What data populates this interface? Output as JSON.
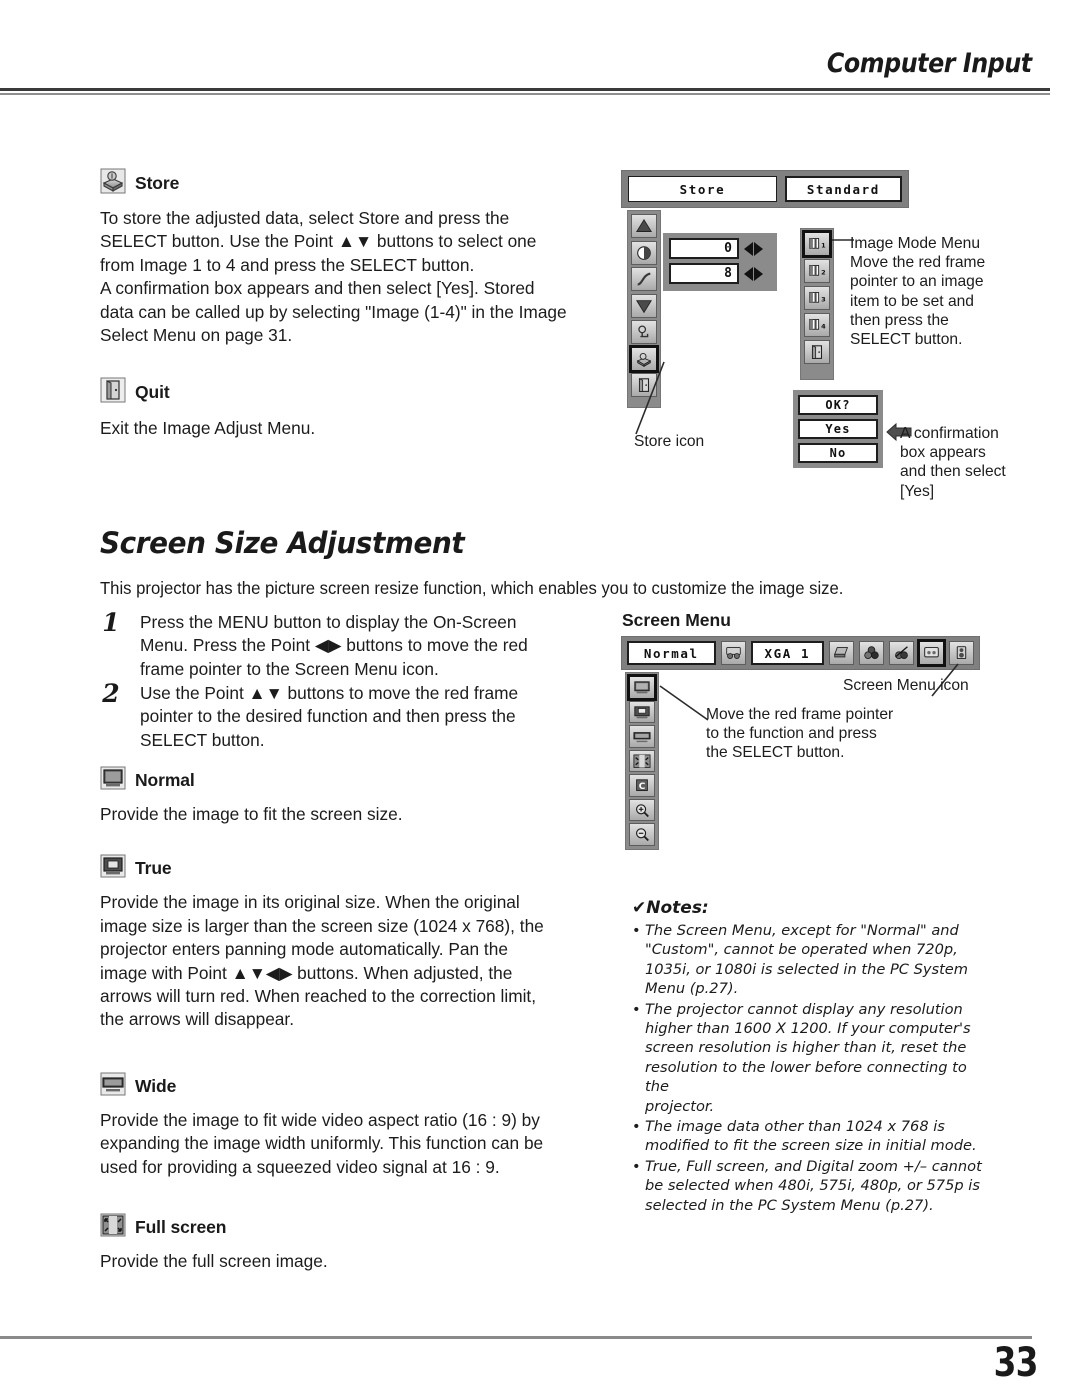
{
  "header": {
    "title": "Computer Input"
  },
  "footer": {
    "page_number": "33"
  },
  "store_section": {
    "heading": "Store",
    "icon": "store-box-icon",
    "body": "To store the adjusted data, select Store and press the\nSELECT button.  Use the Point ▲▼ buttons to select one\nfrom Image 1 to 4 and press the SELECT button.\nA confirmation box appears and then select [Yes]. Stored\ndata can be called up by selecting \"Image (1-4)\" in the Image\nSelect Menu on page 31."
  },
  "quit_section": {
    "heading": "Quit",
    "icon": "door-icon",
    "body": "Exit the Image Adjust Menu."
  },
  "image_adjust_osd": {
    "top_fields": [
      {
        "label": "Store"
      },
      {
        "label": "Standard"
      }
    ],
    "values": [
      "0",
      "8"
    ],
    "left_rail_icons": [
      "contrast-up-icon",
      "brightness-icon",
      "gamma-curve-icon",
      "contrast-down-icon",
      "reset-icon",
      "store-box-icon",
      "door-icon"
    ],
    "selected_left_icon_index": 5,
    "mode_rail_icons": [
      "image-1-icon",
      "image-2-icon",
      "image-3-icon",
      "image-4-icon",
      "door-icon"
    ],
    "mode_rail_labels": [
      "1",
      "2",
      "3",
      "4",
      ""
    ],
    "selected_mode_index": 0,
    "confirm_box": {
      "title": "OK?",
      "yes": "Yes",
      "no": "No"
    },
    "callouts": {
      "image_mode_menu": "Image Mode Menu\nMove the red frame\npointer to an image\nitem to be set and\nthen press the\nSELECT button.",
      "store_icon": "Store icon",
      "confirmation": "A confirmation\nbox appears\nand then select\n[Yes]"
    }
  },
  "screen_size": {
    "title": "Screen Size Adjustment",
    "intro": "This projector has the picture screen resize function, which enables you to customize the image size.",
    "steps": [
      {
        "num": "1",
        "text": "Press the MENU button to display the On-Screen\nMenu.  Press the Point ◀▶ buttons to move the red\nframe pointer to the Screen Menu icon."
      },
      {
        "num": "2",
        "text": "Use the Point ▲▼ buttons to move the red frame\npointer to the desired function and then press the\nSELECT button."
      }
    ],
    "modes": [
      {
        "heading": "Normal",
        "icon": "screen-normal-icon",
        "body": "Provide the image to fit the screen size."
      },
      {
        "heading": "True",
        "icon": "screen-true-icon",
        "body": "Provide the image in its original size.  When the original\nimage size is larger than the screen size (1024 x 768), the\nprojector enters panning mode automatically.  Pan the\nimage with Point ▲▼◀▶ buttons.  When adjusted, the\narrows will turn red.  When reached to the correction limit,\nthe arrows will disappear."
      },
      {
        "heading": "Wide",
        "icon": "screen-wide-icon",
        "body": "Provide the image to fit wide video aspect ratio (16 : 9) by\nexpanding the image width uniformly.  This function can be\nused for providing a squeezed video signal at 16 : 9."
      },
      {
        "heading": "Full screen",
        "icon": "screen-full-icon",
        "body": "Provide the full screen image."
      }
    ]
  },
  "screen_menu_osd": {
    "label": "Screen Menu",
    "fields": [
      {
        "label": "Normal"
      },
      {
        "label": "XGA 1"
      }
    ],
    "bar_icons": [
      "pc-system-icon",
      "laptop-input-icon",
      "color-balls-icon",
      "image-adjust-icon",
      "screen-icon",
      "sound-icon"
    ],
    "selected_bar_icon": "screen-icon",
    "rail_icons": [
      "screen-normal-icon",
      "screen-true-icon",
      "screen-wide-icon",
      "screen-full-icon",
      "custom-c-icon",
      "digital-zoom-in-icon",
      "digital-zoom-out-icon"
    ],
    "selected_rail_index": 0,
    "callouts": {
      "screen_menu_icon": "Screen Menu icon",
      "move_pointer": "Move the red frame pointer\nto  the  function  and  press\nthe SELECT button."
    }
  },
  "notes": {
    "heading": "Notes:",
    "items": [
      "The Screen Menu, except for \"Normal\" and\n\"Custom\", cannot be operated when 720p,\n1035i, or 1080i is selected in the PC System\nMenu  (p.27).",
      "The projector cannot display any resolution\nhigher than 1600 X 1200.  If your computer's\nscreen resolution is higher than it, reset the\nresolution to the lower before connecting to the\nprojector.",
      "The image data other than  1024 x 768  is\nmodified to fit the screen size in initial mode.",
      "True, Full screen, and Digital zoom +/– cannot\nbe selected when 480i, 575i, 480p, or 575p is\nselected in the PC System Menu  (p.27)."
    ]
  }
}
